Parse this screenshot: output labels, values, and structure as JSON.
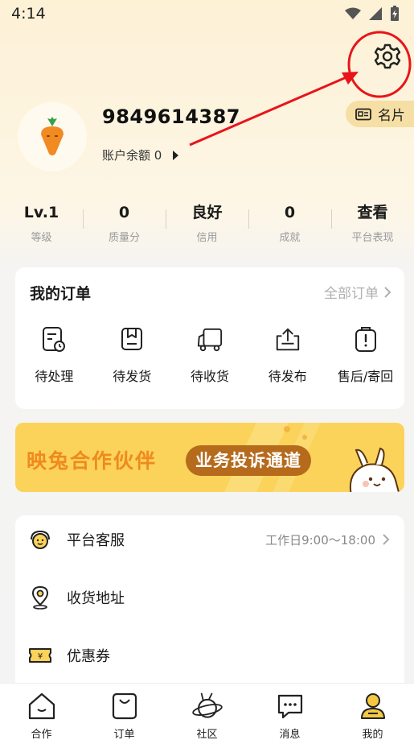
{
  "status_bar": {
    "time": "4:14"
  },
  "profile": {
    "username": "9849614387",
    "balance_label": "账户余额 0",
    "card_label": "名片"
  },
  "stats": [
    {
      "value": "Lv.1",
      "label": "等级"
    },
    {
      "value": "0",
      "label": "质量分"
    },
    {
      "value": "良好",
      "label": "信用"
    },
    {
      "value": "0",
      "label": "成就"
    },
    {
      "value": "查看",
      "label": "平台表现"
    }
  ],
  "orders": {
    "title": "我的订单",
    "view_all": "全部订单",
    "items": [
      {
        "label": "待处理",
        "icon": "pending-icon"
      },
      {
        "label": "待发货",
        "icon": "to-ship-icon"
      },
      {
        "label": "待收货",
        "icon": "truck-icon"
      },
      {
        "label": "待发布",
        "icon": "upload-icon"
      },
      {
        "label": "售后/寄回",
        "icon": "after-sales-icon"
      }
    ]
  },
  "banner": {
    "left_text": "映兔合作伙伴",
    "pill_text": "业务投诉通道"
  },
  "menu": [
    {
      "label": "平台客服",
      "extra": "工作日9:00〜18:00",
      "icon": "customer-service-icon"
    },
    {
      "label": "收货地址",
      "extra": "",
      "icon": "location-icon"
    },
    {
      "label": "优惠券",
      "extra": "",
      "icon": "coupon-icon"
    }
  ],
  "tabs": [
    {
      "label": "合作",
      "icon": "home-icon"
    },
    {
      "label": "订单",
      "icon": "bag-icon"
    },
    {
      "label": "社区",
      "icon": "planet-icon"
    },
    {
      "label": "消息",
      "icon": "message-icon"
    },
    {
      "label": "我的",
      "icon": "profile-icon"
    }
  ],
  "colors": {
    "accent_yellow": "#fbd35a",
    "banner_orange": "#ef8a1e",
    "pill_brown": "#b56a1c",
    "annotation_red": "#e8141a",
    "active_tab": "#f5c842"
  }
}
